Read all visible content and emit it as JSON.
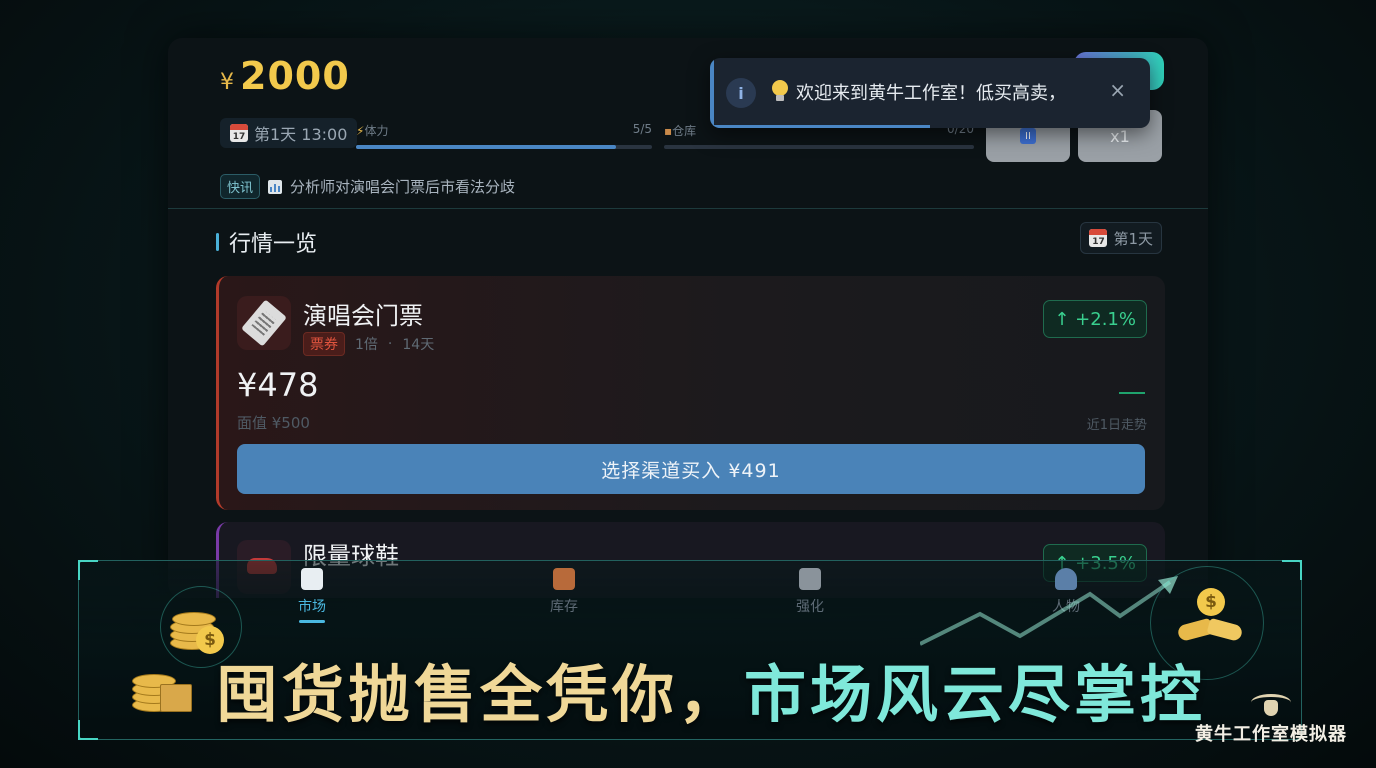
{
  "header": {
    "currency_symbol": "¥",
    "money": "2000",
    "day_time": "第1天 13:00",
    "calendar_day": "17",
    "stamina": {
      "label": "体力",
      "value": "5/5",
      "fraction": 0.88
    },
    "warehouse": {
      "label": "仓库",
      "value": "0/20",
      "fraction": 0.0
    },
    "pause_label": "II",
    "speed_label": "x1"
  },
  "ticker": {
    "tag": "快讯",
    "text": "分析师对演唱会门票后市看法分歧"
  },
  "toast": {
    "info_icon": "i",
    "message": "欢迎来到黄牛工作室！低买高卖，",
    "close_label": "×"
  },
  "market": {
    "title": "行情一览",
    "day_badge": "第1天",
    "items": [
      {
        "name": "演唱会门票",
        "category": "票券",
        "multiplier": "1倍",
        "days": "14天",
        "change": "↑ +2.1%",
        "price": "¥478",
        "face_value": "面值 ¥500",
        "trend_label": "近1日走势",
        "buy_label": "选择渠道买入  ¥491"
      },
      {
        "name": "限量球鞋",
        "change": "↑ +3.5%"
      }
    ]
  },
  "nav": {
    "items": [
      {
        "label": "市场",
        "active": true
      },
      {
        "label": "库存",
        "active": false
      },
      {
        "label": "强化",
        "active": false
      },
      {
        "label": "人物",
        "active": false
      }
    ]
  },
  "promo": {
    "slogan_part1": "囤货抛售全凭你，",
    "slogan_part2": "市场风云尽掌控",
    "brand": "黄牛工作室模拟器",
    "dollar_sign": "$"
  },
  "colors": {
    "money_gold": "#f2c94c",
    "positive_green": "#39d08f",
    "buy_button": "#4a83b8",
    "ticket_accent": "#b23a2a",
    "sneaker_accent": "#7a3aa8",
    "slogan_gold": "#f0d898",
    "slogan_teal": "#7fe8da"
  }
}
